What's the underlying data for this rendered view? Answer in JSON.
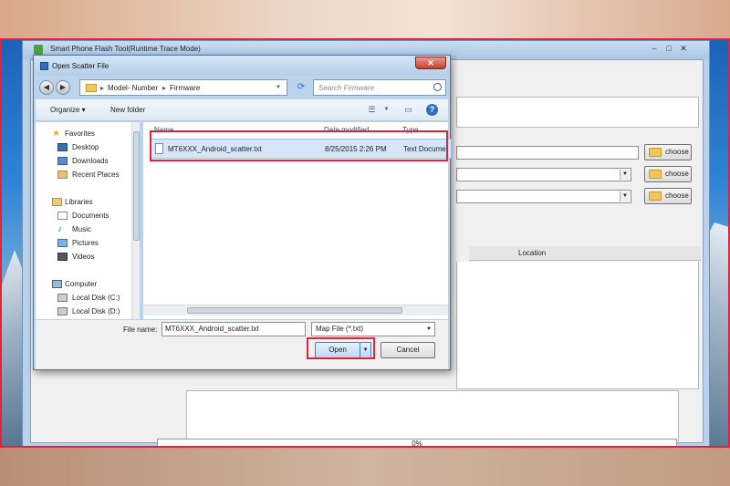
{
  "app": {
    "title": "Smart Phone Flash Tool(Runtime Trace Mode)",
    "choose_label": "choose",
    "location_header": "Location",
    "progress_text": "0%",
    "progress_value": 0
  },
  "dialog": {
    "title": "Open Scatter File",
    "breadcrumb": [
      "Model- Number",
      "Firmware"
    ],
    "search_placeholder": "Search Firmware",
    "toolbar": {
      "organize": "Organize ▾",
      "new_folder": "New folder"
    },
    "nav": {
      "favorites": "Favorites",
      "desktop": "Desktop",
      "downloads": "Downloads",
      "recent_places": "Recent Places",
      "libraries": "Libraries",
      "documents": "Documents",
      "music": "Music",
      "pictures": "Pictures",
      "videos": "Videos",
      "computer": "Computer",
      "local_c": "Local Disk (C:)",
      "local_d": "Local Disk (D:)"
    },
    "columns": {
      "name": "Name",
      "date": "Date modified",
      "type": "Type"
    },
    "files": [
      {
        "name": "MT6XXX_Android_scatter.txt",
        "date": "8/25/2015 2:26 PM",
        "type": "Text Docume"
      }
    ],
    "file_name_label": "File name:",
    "file_name_value": "MT6XXX_Android_scatter.txt",
    "file_type": "Map File (*.txt)",
    "open_label": "Open",
    "cancel_label": "Cancel"
  },
  "colors": {
    "highlight_outline": "#e0243b",
    "selected_row": "#d7e6f7"
  }
}
